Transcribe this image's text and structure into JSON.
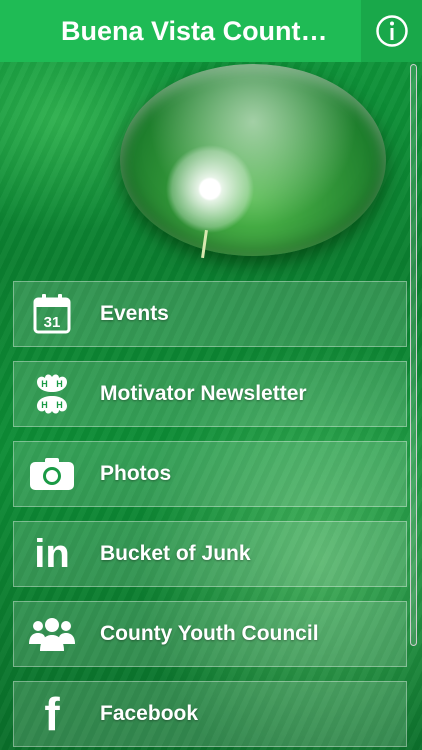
{
  "header": {
    "title": "Buena Vista Count…",
    "info_icon": "info-circle-icon"
  },
  "menu": {
    "items": [
      {
        "label": "Events",
        "icon": "calendar-icon",
        "day": "31"
      },
      {
        "label": "Motivator Newsletter",
        "icon": "four-leaf-clover-icon"
      },
      {
        "label": "Photos",
        "icon": "camera-icon"
      },
      {
        "label": "Bucket of Junk",
        "icon": "linkedin-icon",
        "icon_text": "in"
      },
      {
        "label": "County Youth Council",
        "icon": "people-group-icon"
      },
      {
        "label": "Facebook",
        "icon": "facebook-icon",
        "icon_text": "f"
      }
    ]
  },
  "colors": {
    "header_bg": "#1fbb55",
    "background": "#0a7a2e",
    "text": "#ffffff"
  }
}
